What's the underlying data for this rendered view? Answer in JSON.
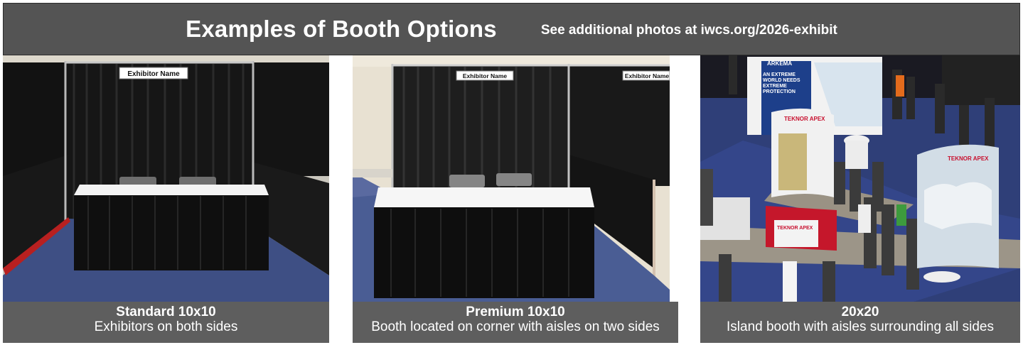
{
  "header": {
    "title": "Examples of Booth Options",
    "subtitle": "See additional photos at iwcs.org/2026-exhibit"
  },
  "panels": [
    {
      "title": "Standard 10x10",
      "description": "Exhibitors on both sides",
      "sign_text": "Exhibitor Name"
    },
    {
      "title": "Premium 10x10",
      "description": "Booth located on corner with aisles on two sides",
      "sign_text": "Exhibitor Name",
      "sign_text_2": "Exhibitor Name"
    },
    {
      "title": "20x20",
      "description": "Island booth with aisles surrounding all sides",
      "sign_arkema": "ARKEMA",
      "sign_extreme": "AN EXTREME WORLD NEEDS EXTREME PROTECTION",
      "sign_teknor": "TEKNOR APEX",
      "sign_teknor_2": "TEKNOR APEX",
      "sign_teknor_3": "TEKNOR APEX"
    }
  ],
  "colors": {
    "banner_bg": "#545454",
    "caption_bg": "#5e5e5e",
    "carpet_blue": "#3c4f88",
    "drape_black": "#151515"
  }
}
